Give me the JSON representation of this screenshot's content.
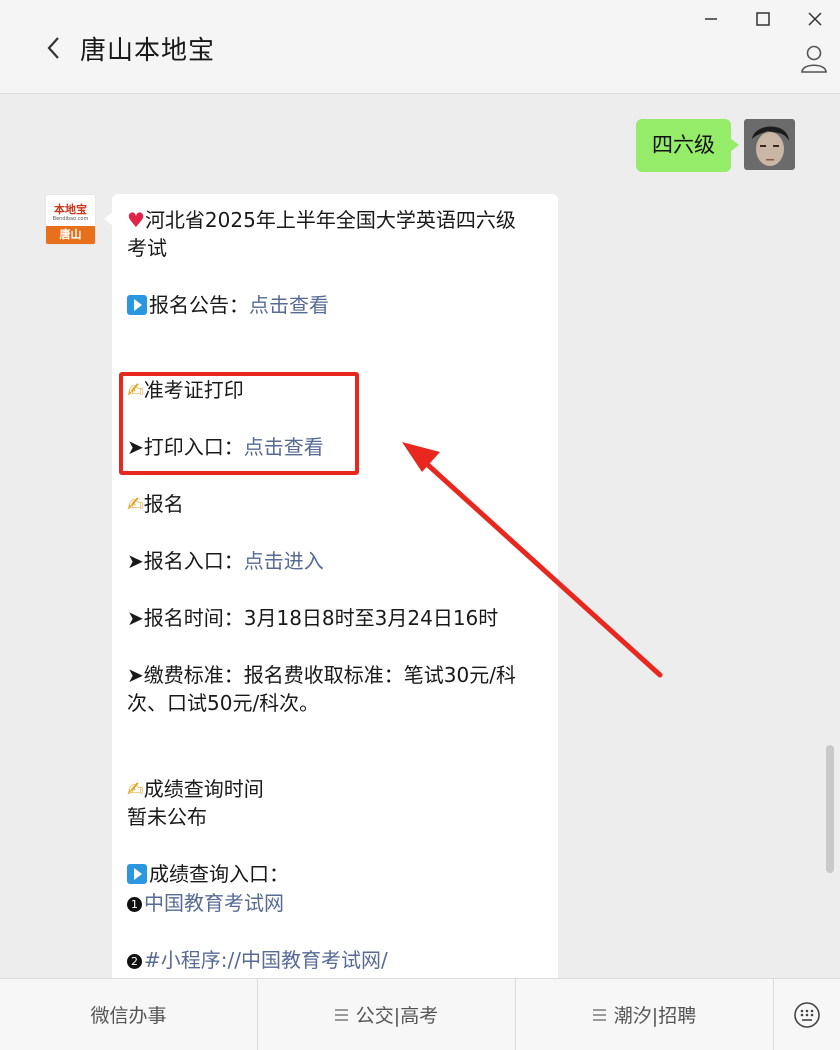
{
  "header": {
    "title": "唐山本地宝",
    "back_icon": "chevron-left-icon",
    "profile_icon": "person-icon",
    "window_controls": [
      "minimize-icon",
      "maximize-icon",
      "close-icon"
    ]
  },
  "chat": {
    "user_message": "四六级",
    "bot_avatar": {
      "logo_top": "本地宝",
      "logo_url": "Bendibao.com",
      "logo_bottom": "唐山"
    },
    "card": {
      "title_line1": "河北省2025年上半年全国大学英语四六级",
      "title_line2": "考试",
      "notice_label": "报名公告：",
      "notice_link": "点击查看",
      "admit_heading": "准考证打印",
      "admit_label": "➤打印入口：",
      "admit_link": "点击查看",
      "reg_heading": "报名",
      "reg_label": "➤报名入口：",
      "reg_link": "点击进入",
      "reg_time": "➤报名时间：3月18日8时至3月24日16时",
      "fee_line1": "➤缴费标准：报名费收取标准：笔试30元/科",
      "fee_line2": "次、口试50元/科次。",
      "score_heading": "成绩查询时间",
      "score_status": "暂未公布",
      "score_entry_label": "成绩查询入口：",
      "score_link1": "中国教育考试网",
      "score_link2": "#小程序://中国教育考试网/"
    },
    "annotation_color": "#e8281f"
  },
  "menu": {
    "items": [
      "微信办事",
      "公交|高考",
      "潮汐|招聘"
    ],
    "keyboard_icon": "keyboard-icon"
  },
  "colors": {
    "user_bubble": "#95ec69",
    "link": "#576b95",
    "background": "#ededed"
  }
}
